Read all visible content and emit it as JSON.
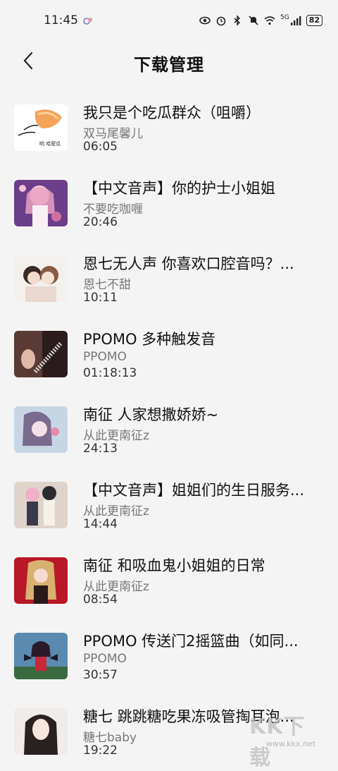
{
  "status_bar": {
    "time": "11:45",
    "network": "5G",
    "battery": "82"
  },
  "header": {
    "title": "下载管理"
  },
  "items": [
    {
      "title": "我只是个吃瓜群众（咀嚼）",
      "author": "双马尾馨儿",
      "duration": "06:05",
      "thumb_caption": "哟 哈密瓜"
    },
    {
      "title": "【中文音声】你的护士小姐姐",
      "author": "不要吃咖喱",
      "duration": "20:46"
    },
    {
      "title": "恩七无人声 你喜欢口腔音吗？...",
      "author": "恩七不甜",
      "duration": "10:11"
    },
    {
      "title": "PPOMO 多种触发音",
      "author": "PPOMO",
      "duration": "01:18:13"
    },
    {
      "title": "南征 人家想撒娇娇~",
      "author": "从此更南征z",
      "duration": "24:13"
    },
    {
      "title": "【中文音声】姐姐们的生日服务...",
      "author": "从此更南征z",
      "duration": "14:44"
    },
    {
      "title": "南征 和吸血鬼小姐姐的日常",
      "author": "从此更南征z",
      "duration": "08:54"
    },
    {
      "title": "PPOMO 传送门2摇篮曲（如同...",
      "author": "PPOMO",
      "duration": "30:57"
    },
    {
      "title": "糖七 跳跳糖吃果冻吸管掏耳泡...",
      "author": "糖七baby",
      "duration": "19:22"
    }
  ],
  "watermark": {
    "text": "KK下载",
    "url": "www.kkx.net"
  }
}
